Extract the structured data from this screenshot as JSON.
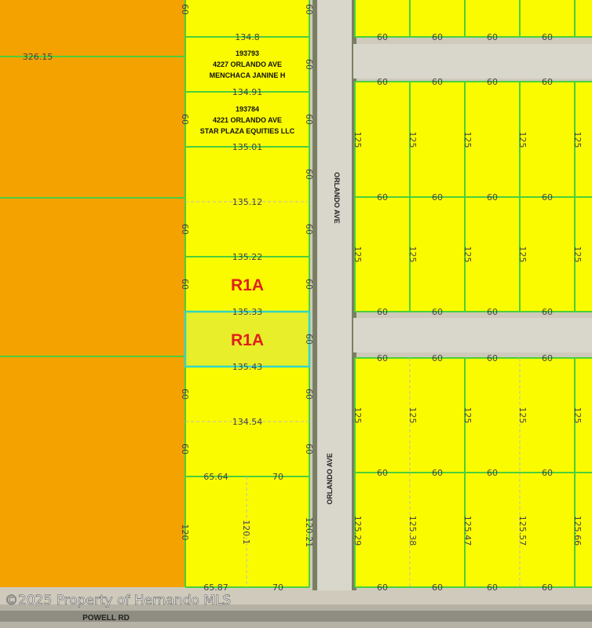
{
  "copyright": "©2025 Property of Hernando MLS",
  "streets": {
    "orlando_upper": "ORLANDO AVE",
    "orlando_lower": "ORLANDO AVE",
    "powell": "POWELL RD"
  },
  "colors": {
    "large_parcel": "#f3a200",
    "residential_parcel": "#fbfb00",
    "parcel_line": "#4ccf3a",
    "selected_outline": "#33d6c2",
    "zone_label": "#e0201a",
    "road": "#d9d6cc"
  },
  "large_parcel": {
    "dim": "326.15"
  },
  "owners": [
    {
      "id": "193793",
      "address": "4227 ORLANDO AVE",
      "name": "MENCHACA JANINE H"
    },
    {
      "id": "193784",
      "address": "4221 ORLANDO AVE",
      "name": "STAR PLAZA EQUITIES LLC"
    }
  ],
  "zones": {
    "upper": "R1A",
    "selected": "R1A"
  },
  "west_column": {
    "widths": [
      "134.8",
      "134.91",
      "135.01",
      "135.12",
      "135.22",
      "135.33",
      "135.43",
      "134.54"
    ],
    "left_side": [
      "60",
      "60",
      "60",
      "60",
      "60",
      "60",
      "60",
      "120"
    ],
    "right_side": [
      "60",
      "60",
      "60",
      "60",
      "60",
      "60",
      "60",
      "60",
      "120.21"
    ],
    "split_lot": {
      "left": "65.64",
      "right": "70",
      "middle": "120.1",
      "bottom_left": "65.87",
      "bottom_right": "70"
    }
  },
  "east_blocks": {
    "top_row": [
      "60",
      "60",
      "60",
      "60"
    ],
    "block_a_top": [
      "60",
      "60",
      "60",
      "60"
    ],
    "block_a_depth": [
      "125",
      "125",
      "125",
      "125",
      "125"
    ],
    "block_a_mid": [
      "60",
      "60",
      "60",
      "60"
    ],
    "block_a_depth2": [
      "125",
      "125",
      "125",
      "125",
      "125"
    ],
    "block_a_bottom": [
      "60",
      "60",
      "60",
      "60"
    ],
    "block_b_top": [
      "60",
      "60",
      "60",
      "60"
    ],
    "block_b_depth": [
      "125",
      "125",
      "125",
      "125",
      "125"
    ],
    "block_b_mid": [
      "60",
      "60",
      "60",
      "60"
    ],
    "block_b_depth2": [
      "125.29",
      "125.38",
      "125.47",
      "125.57",
      "125.66"
    ],
    "block_b_bottom": [
      "60",
      "60",
      "60",
      "60"
    ]
  }
}
